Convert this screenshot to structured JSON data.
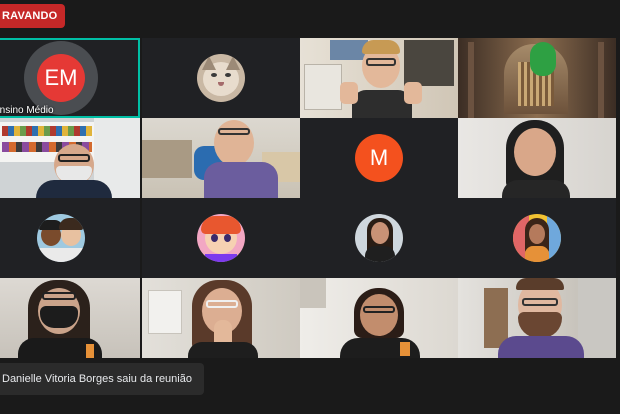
{
  "recording": {
    "label": "RAVANDO"
  },
  "tiles": [
    {
      "id": "em",
      "initials": "EM",
      "name": "Ensino Médio",
      "avatar_color": "#e53935"
    },
    {
      "id": "cat",
      "avatar": "cat-photo-icon"
    },
    {
      "id": "thumbs",
      "avatar": "video-man-thumbs-up"
    },
    {
      "id": "cathedral",
      "avatar": "video-cathedral-background"
    },
    {
      "id": "bearded",
      "avatar": "video-man-bookshelf"
    },
    {
      "id": "glasses",
      "avatar": "video-man-office"
    },
    {
      "id": "m",
      "initials": "M",
      "avatar_color": "#f4511e"
    },
    {
      "id": "woman1",
      "avatar": "video-woman-plain-wall"
    },
    {
      "id": "boys",
      "avatar": "avatar-cartoon-boys-icon"
    },
    {
      "id": "pink",
      "avatar": "avatar-cartoon-girl-pink-icon"
    },
    {
      "id": "woman2",
      "avatar": "avatar-woman-photo-icon"
    },
    {
      "id": "woman3",
      "avatar": "avatar-woman-colorful-icon"
    },
    {
      "id": "mask",
      "avatar": "video-woman-mask"
    },
    {
      "id": "clap",
      "avatar": "video-woman-hands-together"
    },
    {
      "id": "older",
      "avatar": "video-older-woman-glasses"
    },
    {
      "id": "beard2",
      "avatar": "video-bearded-man-glasses"
    }
  ],
  "toast": {
    "text": "Danielle Vitoria Borges saiu da reunião"
  },
  "colors": {
    "accent": "#00bfa5",
    "background": "#1a1a1a",
    "tile": "#3c4043",
    "recording": "#c62828"
  }
}
